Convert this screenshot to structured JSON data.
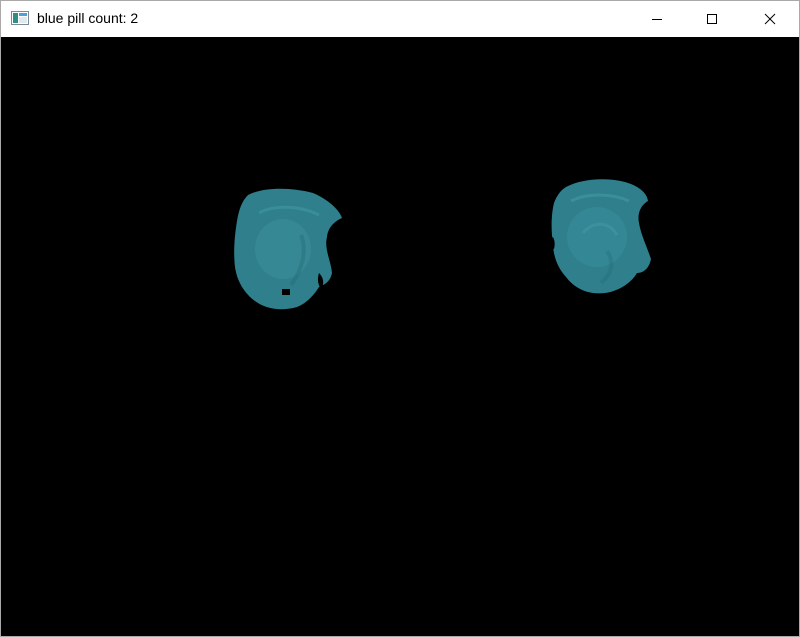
{
  "window": {
    "title": "blue pill count: 2"
  },
  "titlebar": {
    "icon": "app-window-icon",
    "buttons": {
      "minimize": "minimize-icon",
      "maximize": "maximize-icon",
      "close": "close-icon"
    }
  },
  "colors": {
    "canvas_background": "#000000",
    "pill": "#2f7f8c",
    "pill_highlight": "#3a929e",
    "titlebar": "#ffffff"
  },
  "detections": {
    "count": 2
  }
}
